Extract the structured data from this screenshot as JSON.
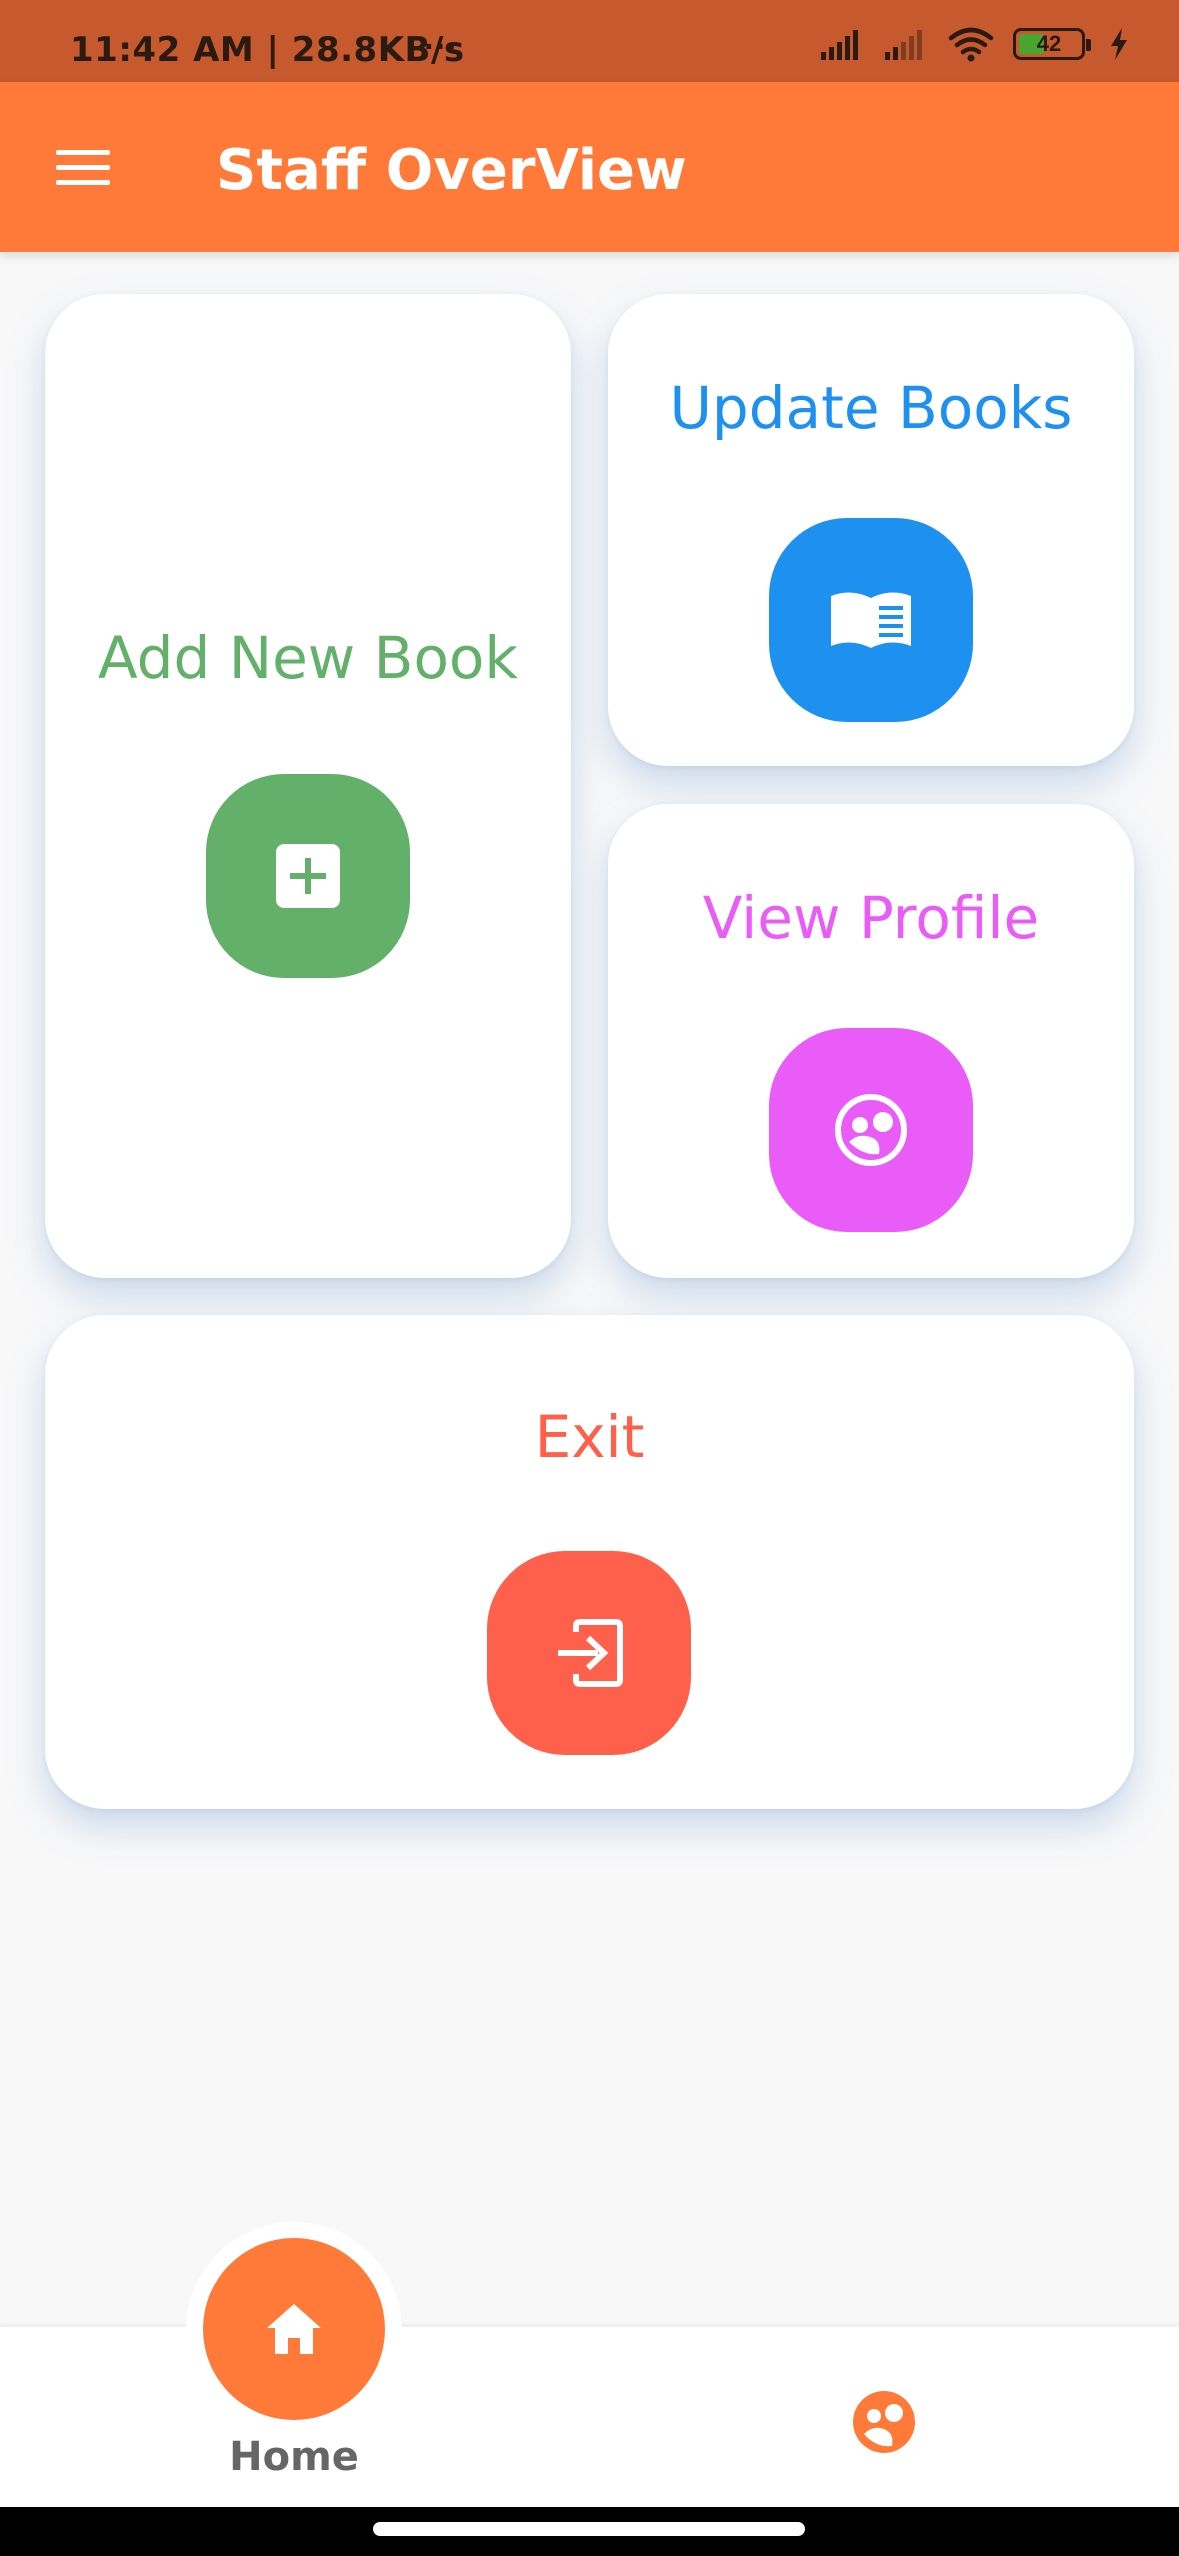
{
  "status_bar": {
    "time_speed": "11:42 AM | 28.8KB/s",
    "more": "···",
    "battery": "42"
  },
  "app_bar": {
    "title": "Staff OverView",
    "menu_icon": "hamburger-menu-icon"
  },
  "cards": {
    "add_book": {
      "label": "Add New Book",
      "color": "#62b06a",
      "icon": "add-box-icon"
    },
    "update_books": {
      "label": "Update Books",
      "color": "#1e90f0",
      "icon": "book-icon"
    },
    "view_profile": {
      "label": "View Profile",
      "color": "#ea5cf8",
      "icon": "profile-face-icon"
    },
    "exit": {
      "label": "Exit",
      "color": "#ff604b",
      "icon": "exit-icon"
    }
  },
  "bottom_nav": {
    "home_label": "Home",
    "home_icon": "home-icon",
    "profile_icon": "profile-icon",
    "accent": "#ff7a38"
  }
}
